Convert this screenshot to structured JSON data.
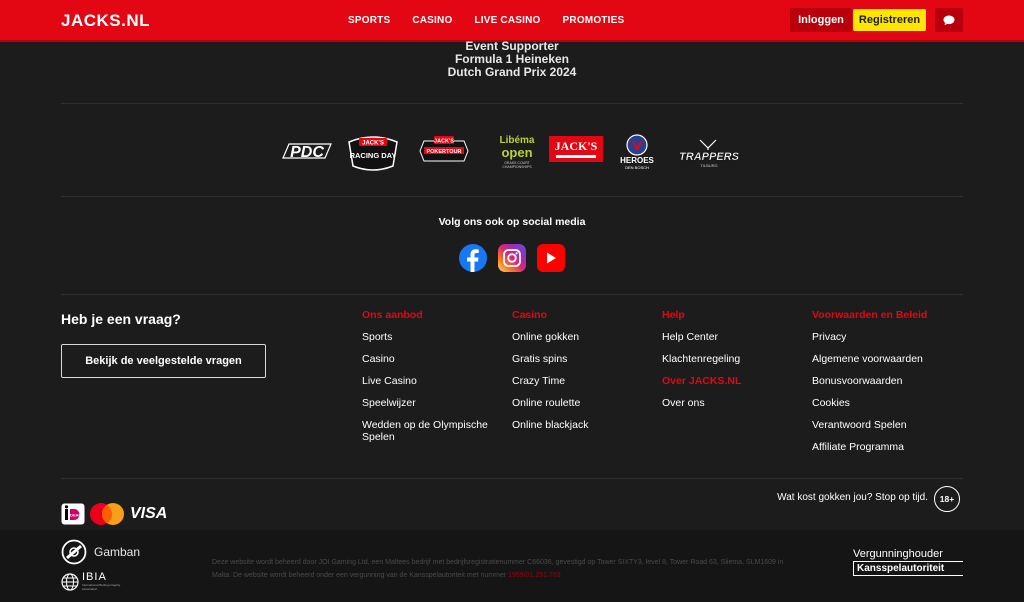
{
  "header": {
    "logo": "JACKS.NL",
    "nav": [
      "SPORTS",
      "CASINO",
      "LIVE CASINO",
      "PROMOTIES"
    ],
    "login": "Inloggen",
    "register": "Registreren",
    "chat_icon": "chat-bubble-icon"
  },
  "event": {
    "line1": "Event Supporter",
    "line2": "Formula 1 Heineken",
    "line3": "Dutch Grand Prix 2024"
  },
  "sponsors": {
    "pdc": "PDC",
    "racing_top": "JACK'S",
    "racing_mid": "RACING DAY",
    "poker_top": "JACK'S",
    "poker_mid": "POKERTOUR",
    "libema1": "Libéma",
    "libema2": "open",
    "libema3": "GRASS COURT CHAMPIONSHIPS",
    "jacks_badge": "JACK'S",
    "heroes": "HEROES",
    "heroes_sub": "DEN BOSCH",
    "trappers": "TRAPPERS",
    "trappers_sub": "TILBURG"
  },
  "social": {
    "title": "Volg ons ook op social media",
    "icons": [
      "facebook-icon",
      "instagram-icon",
      "youtube-icon"
    ]
  },
  "help": {
    "question": "Heb je een vraag?",
    "faq_button": "Bekijk de veelgestelde vragen"
  },
  "columns": {
    "aanbod": {
      "heading": "Ons aanbod",
      "links": [
        "Sports",
        "Casino",
        "Live Casino",
        "Speelwijzer",
        "Wedden op de Olympische Spelen"
      ]
    },
    "casino": {
      "heading": "Casino",
      "links": [
        "Online gokken",
        "Gratis spins",
        "Crazy Time",
        "Online roulette",
        "Online blackjack"
      ]
    },
    "help": {
      "heading": "Help",
      "links": [
        "Help Center",
        "Klachtenregeling"
      ],
      "heading2": "Over JACKS.NL",
      "links2": [
        "Over ons"
      ]
    },
    "voorwaarden": {
      "heading": "Voorwaarden en Beleid",
      "links": [
        "Privacy",
        "Algemene voorwaarden",
        "Bonusvoorwaarden",
        "Cookies",
        "Verantwoord Spelen",
        "Affiliate Programma"
      ]
    }
  },
  "payments": {
    "ideal": "iDEAL",
    "visa": "VISA"
  },
  "age": {
    "text": "Wat kost gokken jou? Stop op tijd.",
    "badge": "18+"
  },
  "bottom": {
    "gamban": "Gamban",
    "ibia": "IBIA",
    "ibia_sub": "International Betting Integrity Association",
    "legal_text": "Deze website wordt beheerd door JOI Gaming Ltd, een Maltees bedrijf met bedrijfsregistratienummer C66036, gevestigd op Tower SIXTY3, level 8, Tower Road 63, Sliema, SLM1609 in Malta. De website wordt beheerd onder een vergunning van de Kansspelautoriteit met nummer ",
    "license_number": "1959/01.251.763",
    "regulator_line1": "Vergunninghouder",
    "regulator_line2": "Kansspelautoriteit"
  },
  "colors": {
    "brand_red": "#e30613",
    "register_yellow": "#ffe600",
    "background": "#1c1c1c"
  }
}
